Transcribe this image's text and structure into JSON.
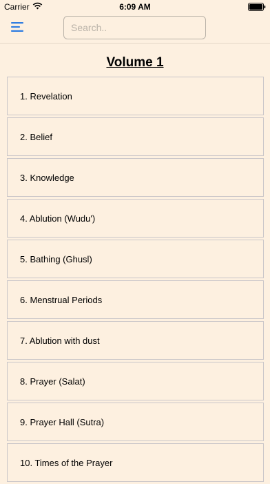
{
  "status_bar": {
    "carrier": "Carrier",
    "time": "6:09 AM",
    "wifi_icon": "wifi-icon",
    "battery_icon": "battery-icon"
  },
  "nav": {
    "menu_icon": "hamburger-menu-icon",
    "accent_color": "#2f7de1",
    "search_placeholder": "Search.."
  },
  "volume_title": "Volume 1",
  "chapters": [
    {
      "label": "1. Revelation"
    },
    {
      "label": "2. Belief"
    },
    {
      "label": "3. Knowledge"
    },
    {
      "label": "4. Ablution (Wudu')"
    },
    {
      "label": "5. Bathing (Ghusl)"
    },
    {
      "label": "6. Menstrual Periods"
    },
    {
      "label": "7. Ablution with dust"
    },
    {
      "label": "8. Prayer (Salat)"
    },
    {
      "label": "9. Prayer Hall (Sutra)"
    },
    {
      "label": "10. Times of the Prayer"
    }
  ]
}
